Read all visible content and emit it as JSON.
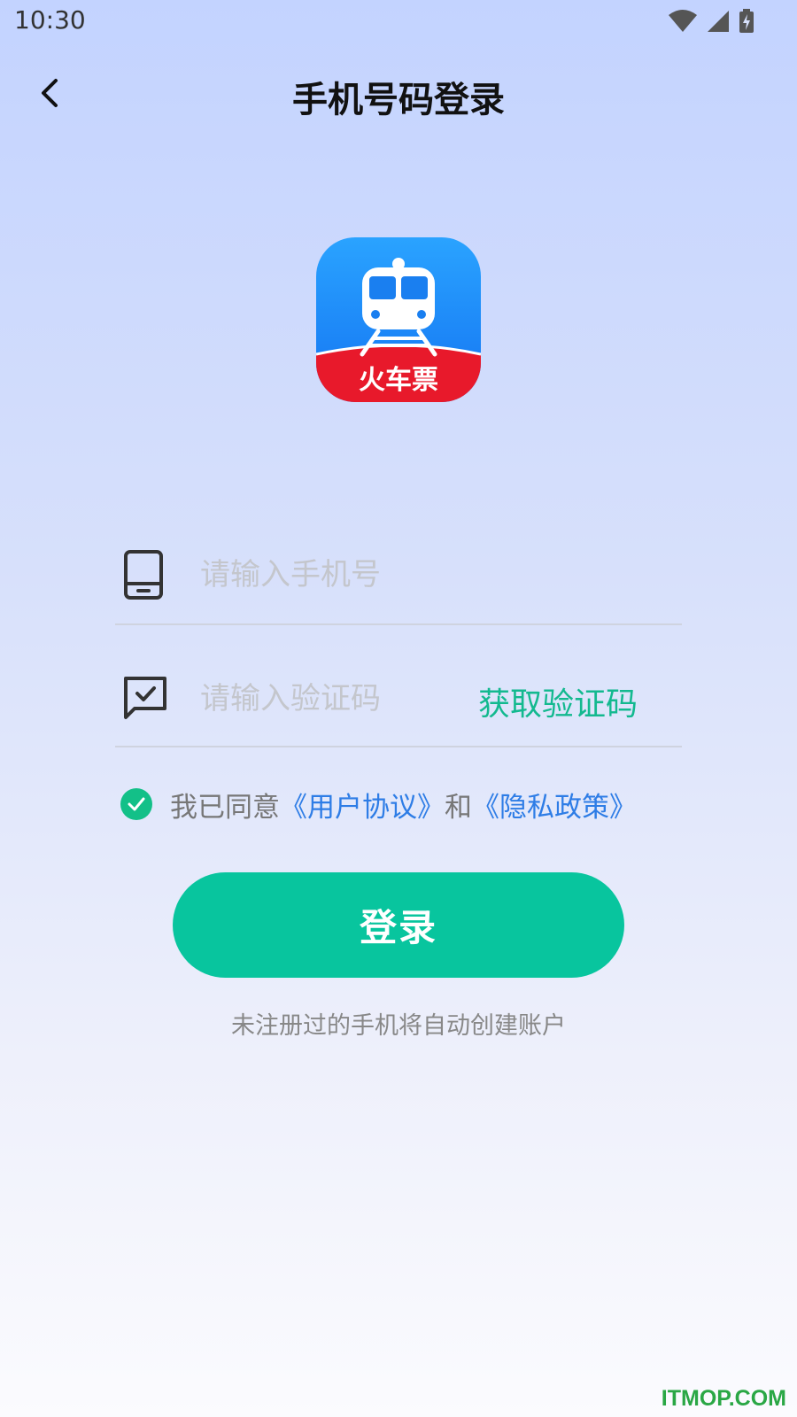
{
  "status_bar": {
    "time": "10:30",
    "icons": [
      "wifi-icon",
      "signal-icon",
      "battery-charging-icon"
    ]
  },
  "header": {
    "title": "手机号码登录",
    "back_icon": "chevron-left-icon"
  },
  "logo": {
    "label": "火车票",
    "icon": "train-icon",
    "colors": {
      "top": "#1f8dff",
      "bottom": "#e8192b"
    }
  },
  "form": {
    "phone": {
      "placeholder": "请输入手机号",
      "value": "",
      "icon": "phone-icon"
    },
    "code": {
      "placeholder": "请输入验证码",
      "value": "",
      "icon": "message-check-icon"
    },
    "get_code_label": "获取验证码"
  },
  "agreement": {
    "checked": true,
    "prefix": "我已同意",
    "user_agreement": "《用户协议》",
    "conjunction": "和",
    "privacy_policy": "《隐私政策》"
  },
  "login_button": "登录",
  "hint": "未注册过的手机将自动创建账户",
  "watermark": "ITMOP.COM",
  "colors": {
    "accent": "#08c59e",
    "link": "#2e7de6",
    "placeholder": "#c4c6cc"
  }
}
